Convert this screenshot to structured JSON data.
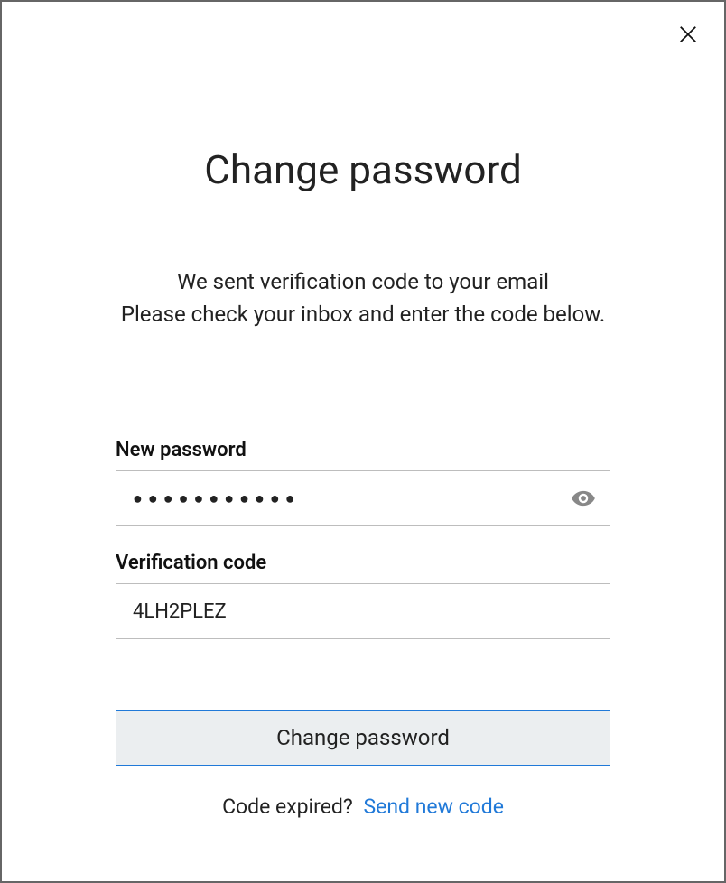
{
  "dialog": {
    "title": "Change password",
    "instructions_line1": "We sent verification code to your email",
    "instructions_line2": "Please check your inbox and enter the code below."
  },
  "form": {
    "new_password": {
      "label": "New password",
      "value": "●●●●●●●●●●●"
    },
    "verification_code": {
      "label": "Verification code",
      "value": "4LH2PLEZ"
    },
    "submit_label": "Change password"
  },
  "footer": {
    "prompt": "Code expired?",
    "link_label": "Send new code"
  },
  "icons": {
    "close": "close-icon",
    "eye": "eye-icon"
  }
}
